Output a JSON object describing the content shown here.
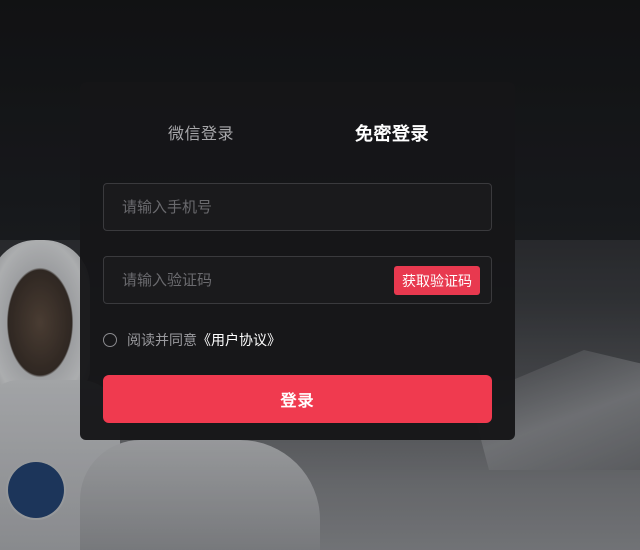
{
  "tabs": {
    "wechat_label": "微信登录",
    "sms_label": "免密登录",
    "active": "sms"
  },
  "phone_field": {
    "placeholder": "请输入手机号",
    "value": ""
  },
  "code_field": {
    "placeholder": "请输入验证码",
    "value": "",
    "get_code_label": "获取验证码"
  },
  "agreement": {
    "checked": false,
    "text": "阅读并同意",
    "link_label": "《用户协议》"
  },
  "login_button_label": "登录",
  "colors": {
    "accent": "#f03a4f",
    "panel_bg": "#161618",
    "active_tab": "#ffffff",
    "inactive_tab": "#a8a8ab"
  }
}
